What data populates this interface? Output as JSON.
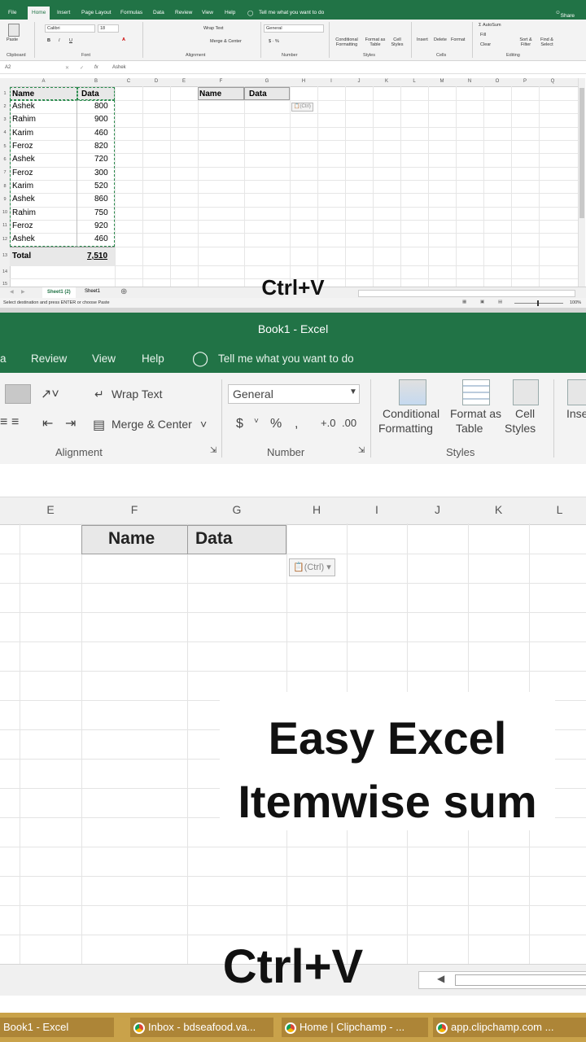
{
  "top": {
    "menu_tabs": [
      "File",
      "Home",
      "Insert",
      "Page Layout",
      "Formulas",
      "Data",
      "Review",
      "View",
      "Help"
    ],
    "tell_me": "Tell me what you want to do",
    "share": "Share",
    "ribbon": {
      "paste": "Paste",
      "font_name": "Calibri",
      "font_size": "18",
      "wrap_text": "Wrap Text",
      "merge_center": "Merge & Center",
      "number_format": "General",
      "conditional": "Conditional Formatting",
      "format_table": "Format as Table",
      "cell_styles": "Cell Styles",
      "insert": "Insert",
      "delete": "Delete",
      "format": "Format",
      "autosum": "AutoSum",
      "fill": "Fill",
      "clear": "Clear",
      "sort_filter": "Sort & Filter",
      "find_select": "Find & Select",
      "groups": [
        "Clipboard",
        "Font",
        "Alignment",
        "Number",
        "Styles",
        "Cells",
        "Editing"
      ]
    },
    "name_box": "A2",
    "formula_value": "Ashek",
    "columns": [
      "A",
      "B",
      "C",
      "D",
      "E",
      "F",
      "G",
      "H",
      "I",
      "J",
      "K",
      "L",
      "M",
      "N",
      "O",
      "P",
      "Q"
    ],
    "rows": [
      "1",
      "2",
      "3",
      "4",
      "5",
      "6",
      "7",
      "8",
      "9",
      "10",
      "11",
      "12",
      "13",
      "14",
      "15"
    ],
    "table_headers": [
      "Name",
      "Data"
    ],
    "table_rows": [
      [
        "Ashek",
        "800"
      ],
      [
        "Rahim",
        "900"
      ],
      [
        "Karim",
        "460"
      ],
      [
        "Feroz",
        "820"
      ],
      [
        "Ashek",
        "720"
      ],
      [
        "Feroz",
        "300"
      ],
      [
        "Karim",
        "520"
      ],
      [
        "Ashek",
        "860"
      ],
      [
        "Rahim",
        "750"
      ],
      [
        "Feroz",
        "920"
      ],
      [
        "Ashek",
        "460"
      ]
    ],
    "total_label": "Total",
    "total_value": "7,510",
    "pasted_headers": [
      "Name",
      "Data"
    ],
    "ctrl_badge": "(Ctrl)",
    "sheet_tabs": [
      "Sheet1 (2)",
      "Sheet1"
    ],
    "status": "Select destination and press ENTER or choose Paste",
    "zoom": "100%",
    "caption": "Ctrl+V"
  },
  "bottom": {
    "title": "Book1 - Excel",
    "menu_tabs": [
      "a",
      "Review",
      "View",
      "Help"
    ],
    "tell_me": "Tell me what you want to do",
    "ribbon": {
      "wrap_text": "Wrap Text",
      "merge_center": "Merge & Center",
      "number_format": "General",
      "conditional_1": "Conditional",
      "conditional_2": "Formatting",
      "format_table_1": "Format as",
      "format_table_2": "Table",
      "cell_styles_1": "Cell",
      "cell_styles_2": "Styles",
      "insert": "Inse",
      "group_alignment": "Alignment",
      "group_number": "Number",
      "group_styles": "Styles"
    },
    "columns": [
      "E",
      "F",
      "G",
      "H",
      "I",
      "J",
      "K",
      "L"
    ],
    "pasted_headers": [
      "Name",
      "Data"
    ],
    "ctrl_badge": "(Ctrl)",
    "overlay_line1": "Easy Excel",
    "overlay_line2": "Itemwise sum",
    "caption": "Ctrl+V",
    "taskbar": [
      "Book1 - Excel",
      "Inbox - bdseafood.va...",
      "Home | Clipchamp - ...",
      "app.clipchamp.com ..."
    ]
  }
}
